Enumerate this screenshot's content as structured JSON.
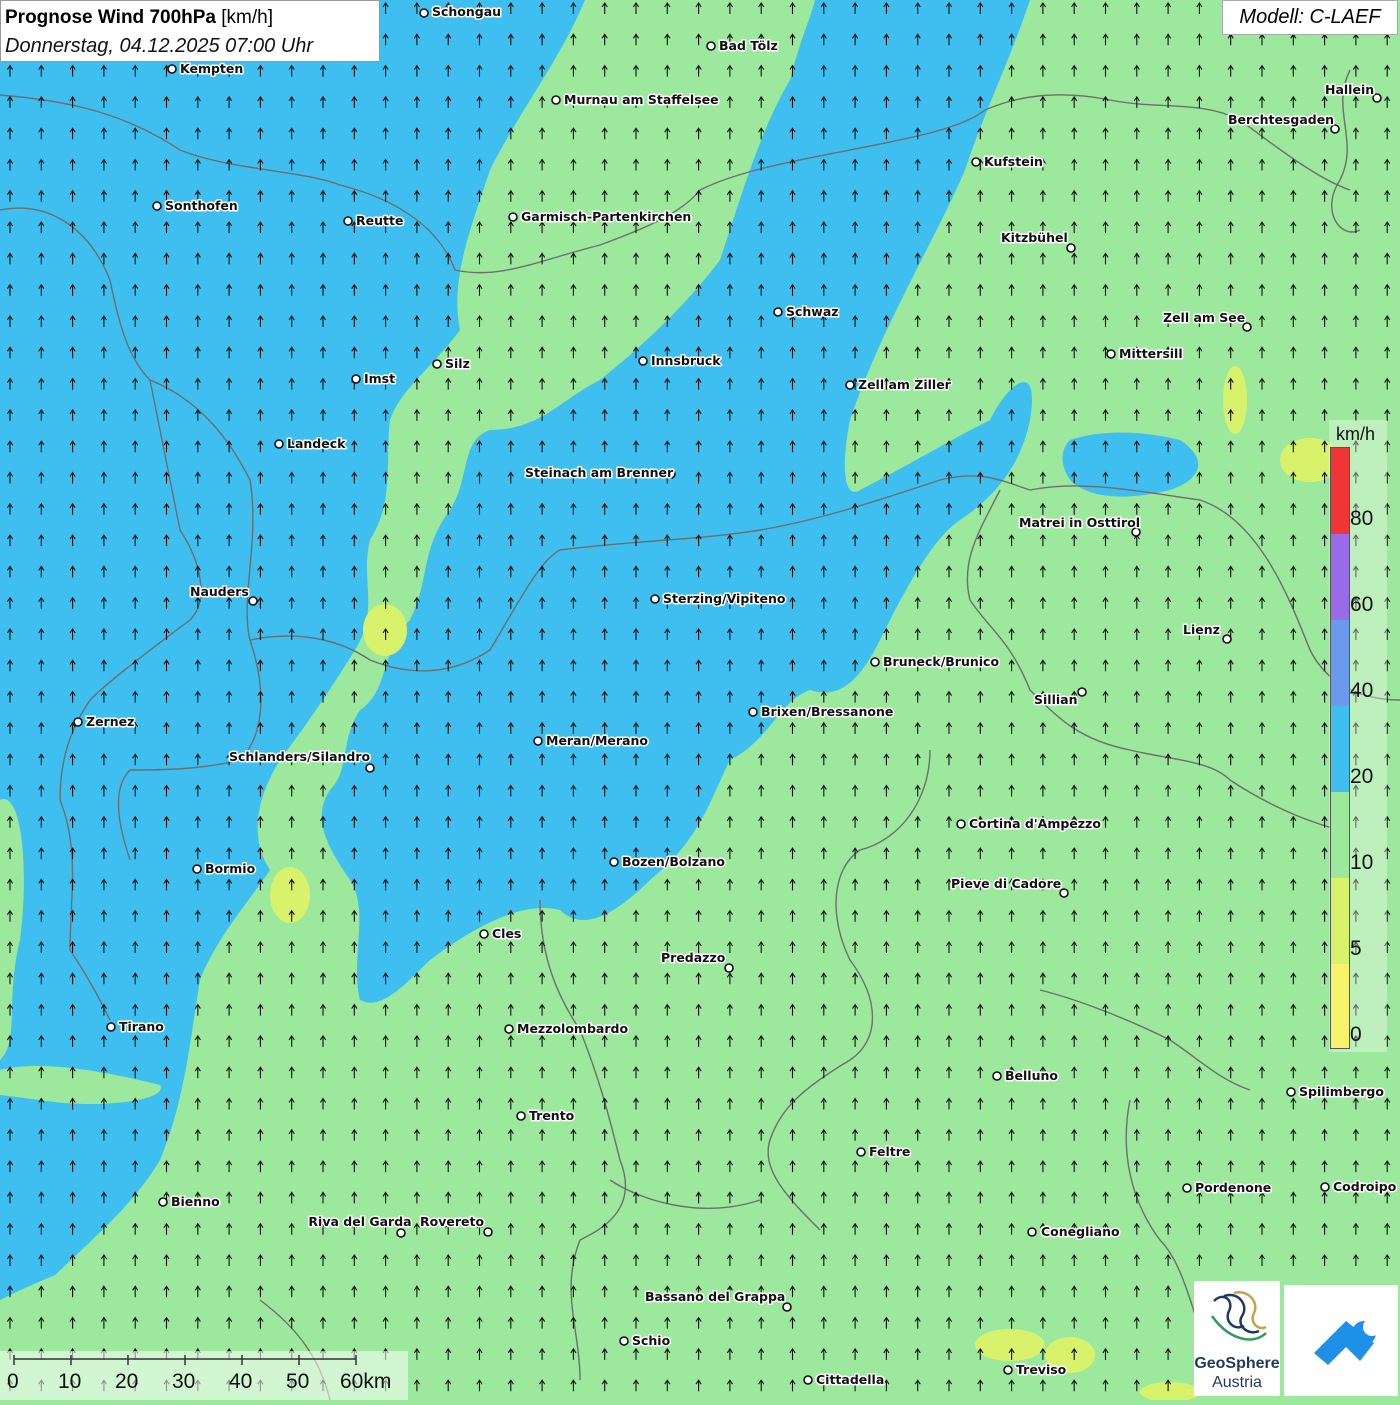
{
  "title": {
    "main_bold": "Prognose Wind 700hPa",
    "main_unit": "[km/h]",
    "date": "Donnerstag, 04.12.2025 07:00 Uhr"
  },
  "model": "Modell: C-LAEF",
  "colors": {
    "wind_0_5": "#f6f36a",
    "wind_5_10": "#d8f26c",
    "wind_10_20": "#9ce89c",
    "wind_20_40": "#3fbff0",
    "wind_40_60": "#6b99ec",
    "wind_60_80": "#9a6be8",
    "wind_80_plus": "#ef3535",
    "borders": "#6e6e6e",
    "arrows": "#111111"
  },
  "legend": {
    "unit": "km/h",
    "ticks": [
      "80",
      "60",
      "40",
      "20",
      "10",
      "5",
      "0"
    ]
  },
  "scale_bar": {
    "labels": [
      "0",
      "10",
      "20",
      "30",
      "40",
      "50",
      "60km"
    ]
  },
  "wind_direction": "south-to-north",
  "cities": [
    {
      "name": "Schongau"
    },
    {
      "name": "Bad Tölz"
    },
    {
      "name": "Kempten"
    },
    {
      "name": "Murnau am Staffelsee"
    },
    {
      "name": "Hallein"
    },
    {
      "name": "Berchtesgaden"
    },
    {
      "name": "Kufstein"
    },
    {
      "name": "Sonthofen"
    },
    {
      "name": "Reutte"
    },
    {
      "name": "Garmisch-Partenkirchen"
    },
    {
      "name": "Kitzbühel"
    },
    {
      "name": "Schwaz"
    },
    {
      "name": "Zell am See"
    },
    {
      "name": "Mittersill"
    },
    {
      "name": "Silz"
    },
    {
      "name": "Innsbruck"
    },
    {
      "name": "Imst"
    },
    {
      "name": "Zell am Ziller"
    },
    {
      "name": "Landeck"
    },
    {
      "name": "Steinach am Brenner"
    },
    {
      "name": "Matrei in Osttirol"
    },
    {
      "name": "Nauders"
    },
    {
      "name": "Sterzing/Vipiteno"
    },
    {
      "name": "Lienz"
    },
    {
      "name": "Bruneck/Brunico"
    },
    {
      "name": "Sillian"
    },
    {
      "name": "Brixen/Bressanone"
    },
    {
      "name": "Zernez"
    },
    {
      "name": "Meran/Merano"
    },
    {
      "name": "Schlanders/Silandro"
    },
    {
      "name": "Cortina d'Ampezzo"
    },
    {
      "name": "Bormio"
    },
    {
      "name": "Bozen/Bolzano"
    },
    {
      "name": "Pieve di Cadore"
    },
    {
      "name": "Cles"
    },
    {
      "name": "Predazzo"
    },
    {
      "name": "Tirano"
    },
    {
      "name": "Mezzolombardo"
    },
    {
      "name": "Belluno"
    },
    {
      "name": "Spilimbergo"
    },
    {
      "name": "Trento"
    },
    {
      "name": "Feltre"
    },
    {
      "name": "Pordenone"
    },
    {
      "name": "Codroipo"
    },
    {
      "name": "Bienno"
    },
    {
      "name": "Riva del Garda"
    },
    {
      "name": "Rovereto"
    },
    {
      "name": "Conegliano"
    },
    {
      "name": "Bassano del Grappa"
    },
    {
      "name": "Schio"
    },
    {
      "name": "Treviso"
    },
    {
      "name": "Cittadella"
    }
  ],
  "logos": {
    "geosphere_line1": "GeoSphere",
    "geosphere_line2": "Austria"
  }
}
